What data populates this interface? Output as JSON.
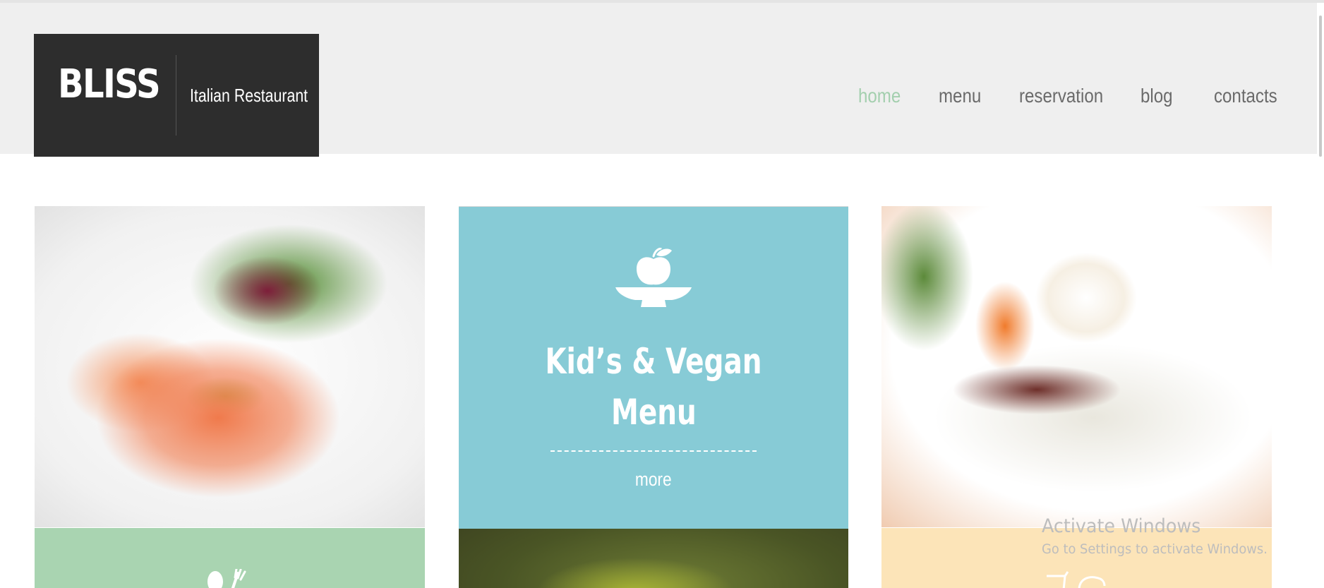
{
  "header": {
    "logo": {
      "name": "BLISS",
      "tagline": "Italian Restaurant"
    },
    "nav": [
      {
        "label": "home",
        "active": true
      },
      {
        "label": "menu",
        "active": false
      },
      {
        "label": "reservation",
        "active": false
      },
      {
        "label": "blog",
        "active": false
      },
      {
        "label": "contacts",
        "active": false
      }
    ]
  },
  "tiles": {
    "kids_vegan": {
      "icon": "apple-bowl-icon",
      "title_line1": "Kid’s & Vegan",
      "title_line2": "Menu",
      "link": "more"
    }
  },
  "watermark": {
    "title": "Activate Windows",
    "subtitle": "Go to Settings to activate Windows."
  },
  "colors": {
    "header_bg": "#efefef",
    "logo_bg": "#2d2d2d",
    "nav_active": "#a3cfae",
    "nav_text": "#6a6a6a",
    "kids_panel": "#87cbd6",
    "green_panel": "#a9d4b1",
    "peach_panel": "#fce4b8"
  }
}
